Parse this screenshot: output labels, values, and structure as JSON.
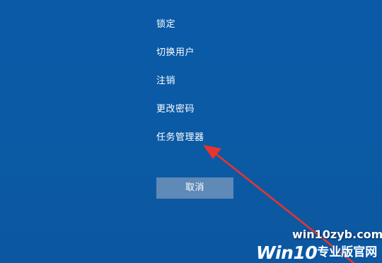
{
  "menu": {
    "items": [
      {
        "label": "锁定"
      },
      {
        "label": "切换用户"
      },
      {
        "label": "注销"
      },
      {
        "label": "更改密码"
      },
      {
        "label": "任务管理器"
      }
    ]
  },
  "cancel_button": {
    "label": "取消"
  },
  "annotation": {
    "arrow_color": "#e8342e"
  },
  "watermark": {
    "url": "win10zyb.com",
    "brand_win": "Win10",
    "brand_cn": "专业版官网"
  },
  "colors": {
    "background": "#0b5aa6",
    "button": "#5f89b6",
    "text": "#ffffff"
  }
}
